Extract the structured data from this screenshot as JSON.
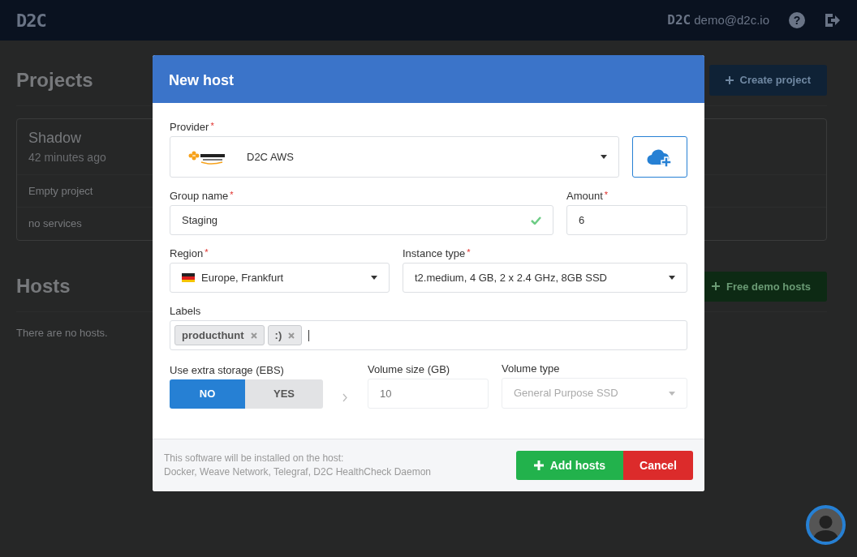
{
  "header": {
    "logo": "D2C",
    "user_badge": "D2C",
    "user_email": "demo@d2c.io",
    "help_glyph": "?"
  },
  "projects": {
    "title": "Projects",
    "create_button": "Create project",
    "items": [
      {
        "name": "Shadow",
        "time": "42 minutes ago",
        "description": "Empty project",
        "services": "no services"
      }
    ]
  },
  "hosts": {
    "title": "Hosts",
    "demo_button": "Free demo hosts",
    "empty_text": "There are no hosts."
  },
  "modal": {
    "title": "New host",
    "provider": {
      "label": "Provider",
      "required_mark": "*",
      "value": "D2C AWS"
    },
    "group_name": {
      "label": "Group name",
      "required_mark": "*",
      "value": "Staging",
      "valid": true
    },
    "amount": {
      "label": "Amount",
      "required_mark": "*",
      "value": "6"
    },
    "region": {
      "label": "Region",
      "required_mark": "*",
      "value": "Europe, Frankfurt"
    },
    "instance_type": {
      "label": "Instance type",
      "required_mark": "*",
      "value": "t2.medium, 4 GB, 2 x 2.4 GHz, 8GB SSD"
    },
    "labels": {
      "label": "Labels",
      "tags": [
        "producthunt",
        ":)"
      ]
    },
    "storage": {
      "label": "Use extra storage (EBS)",
      "options": [
        {
          "label": "NO",
          "selected": true
        },
        {
          "label": "YES",
          "selected": false
        }
      ]
    },
    "volume_size": {
      "label": "Volume size (GB)",
      "placeholder": "10",
      "disabled": true
    },
    "volume_type": {
      "label": "Volume type",
      "value": "General Purpose SSD",
      "disabled": true
    },
    "footer_note": [
      "This software will be installed on the host:",
      "Docker, Weave Network, Telegraf, D2C HealthCheck Daemon"
    ],
    "add_button": "Add hosts",
    "cancel_button": "Cancel"
  }
}
